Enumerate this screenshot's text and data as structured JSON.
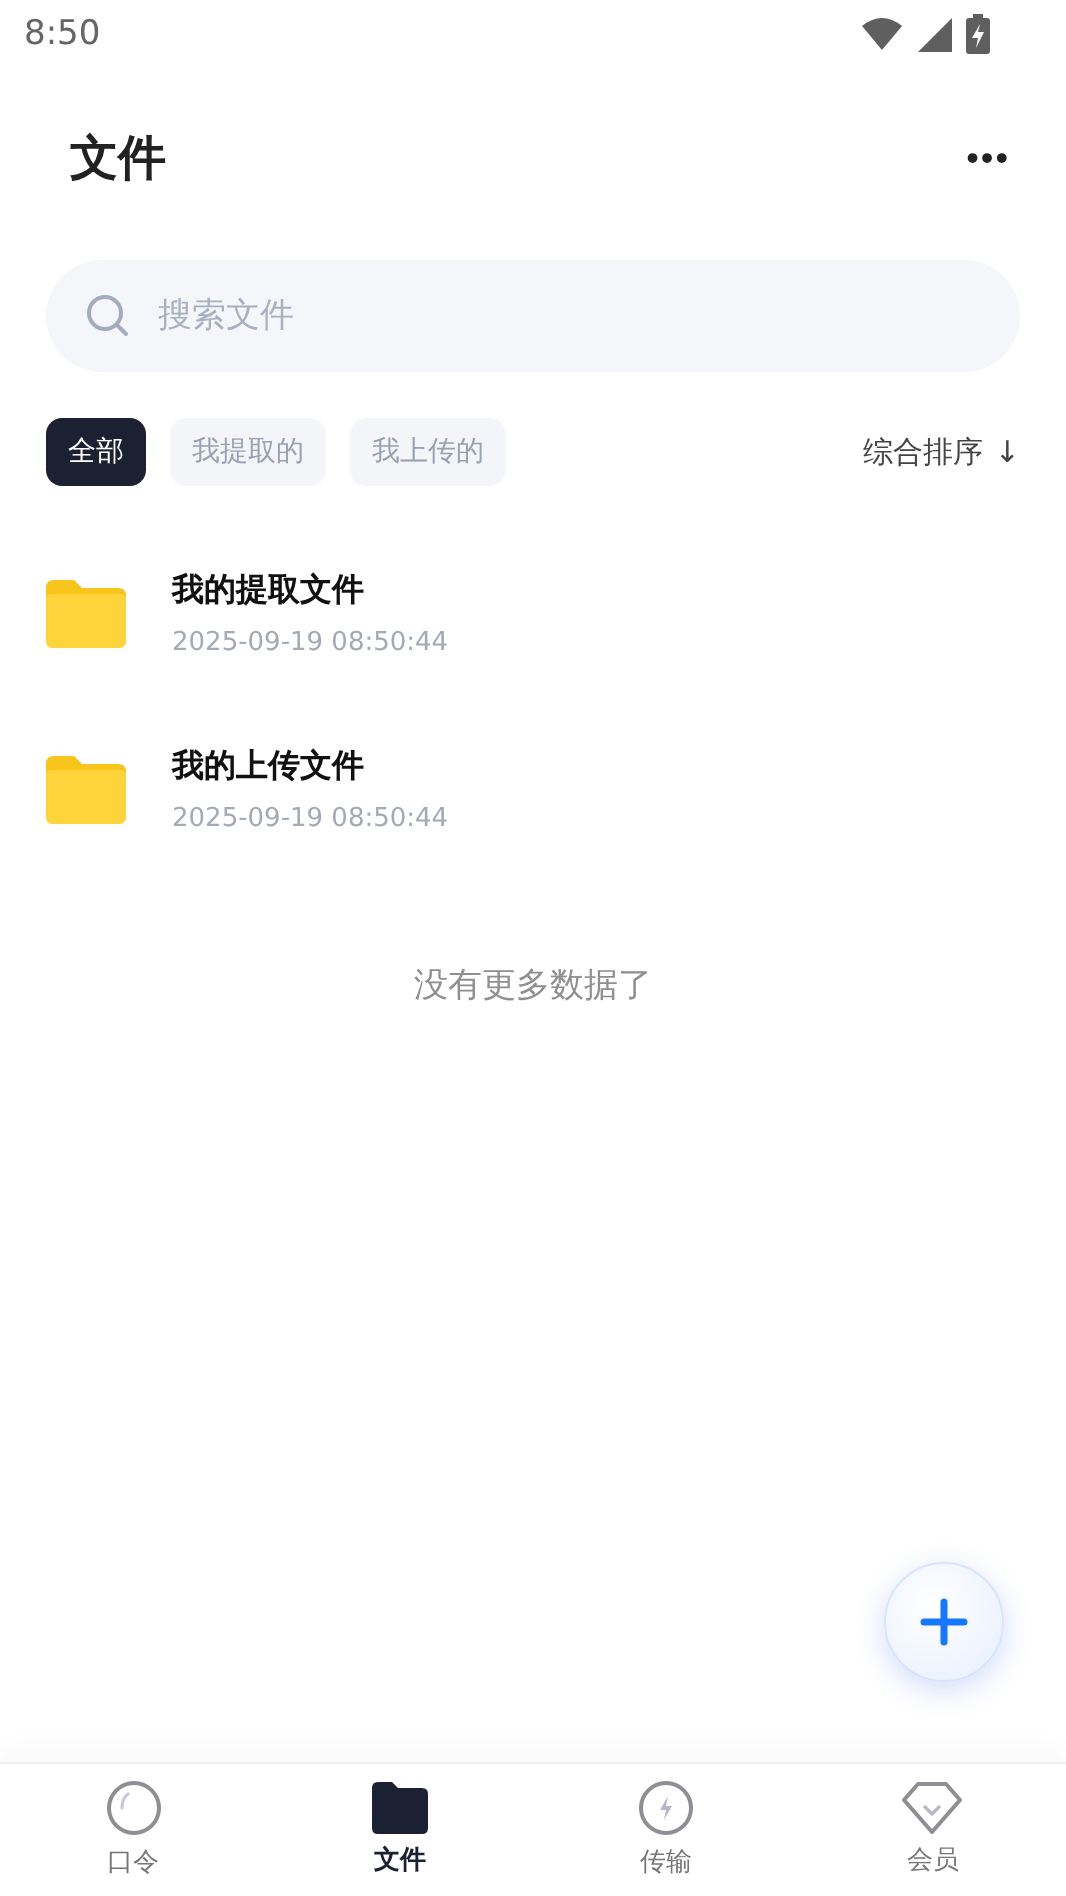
{
  "status_bar": {
    "time": "8:50"
  },
  "header": {
    "title": "文件",
    "more": "•••"
  },
  "search": {
    "placeholder": "搜索文件"
  },
  "filters": [
    {
      "label": "全部",
      "selected": true
    },
    {
      "label": "我提取的",
      "selected": false
    },
    {
      "label": "我上传的",
      "selected": false
    }
  ],
  "sort": {
    "label": "综合排序",
    "arrow": "↓"
  },
  "files": [
    {
      "name": "我的提取文件",
      "time": "2025-09-19 08:50:44"
    },
    {
      "name": "我的上传文件",
      "time": "2025-09-19 08:50:44"
    }
  ],
  "empty_note": "没有更多数据了",
  "tabs": [
    {
      "label": "口令",
      "kind": "ring",
      "selected": false
    },
    {
      "label": "文件",
      "kind": "folder",
      "selected": true
    },
    {
      "label": "传输",
      "kind": "bolt",
      "selected": false
    },
    {
      "label": "会员",
      "kind": "gem",
      "selected": false
    }
  ]
}
